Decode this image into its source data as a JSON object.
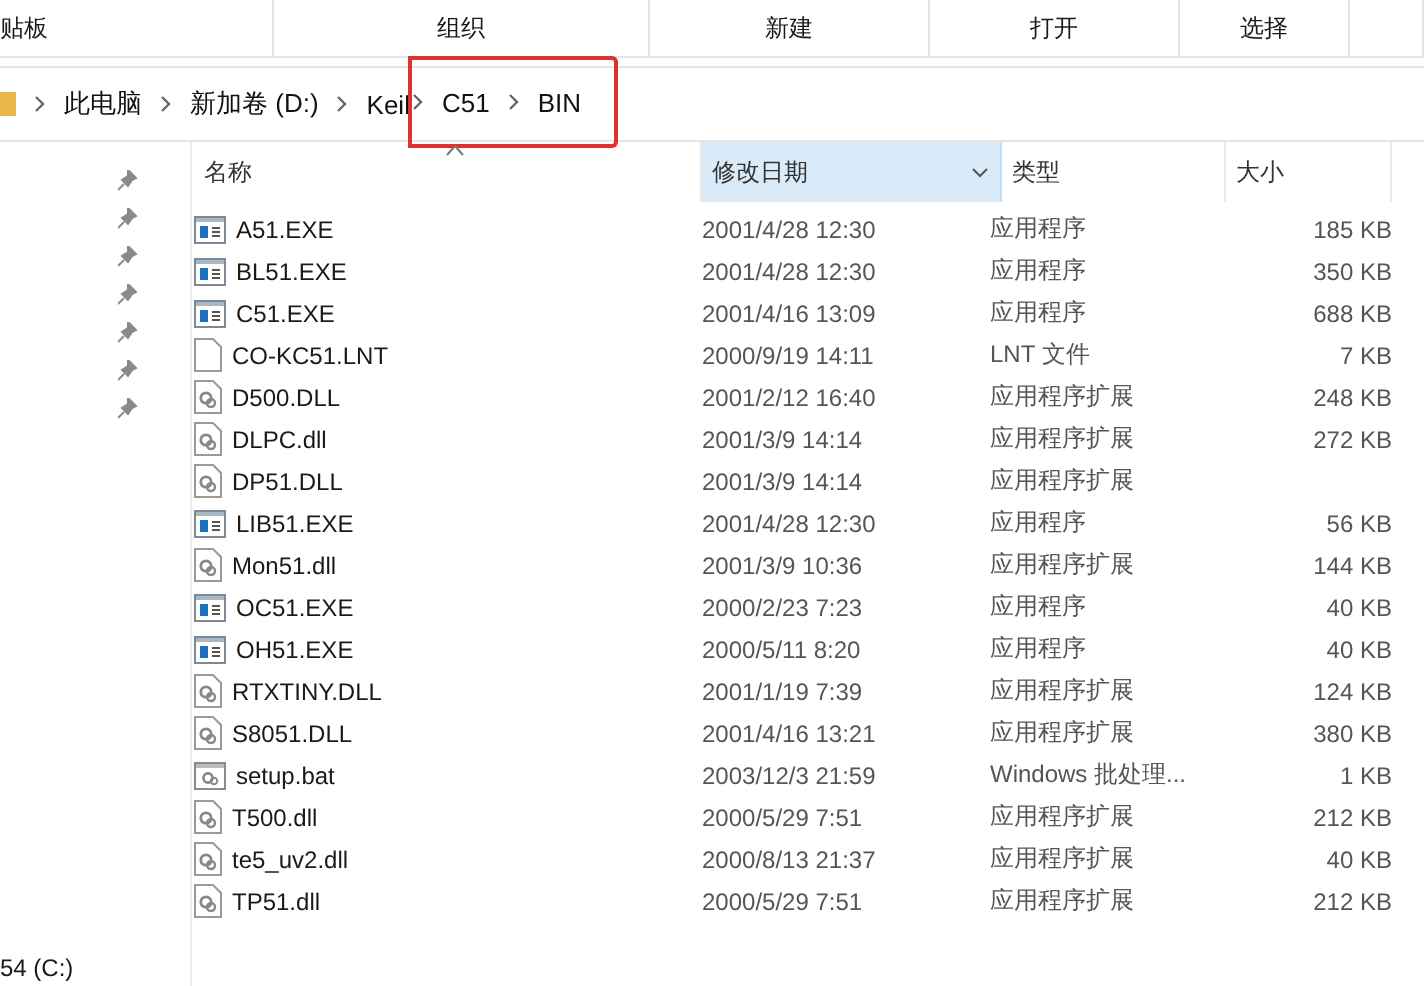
{
  "ribbon": {
    "groups": [
      "贴板",
      "组织",
      "新建",
      "打开",
      "选择"
    ]
  },
  "address_bar": {
    "segments": [
      "此电脑",
      "新加卷 (D:)",
      "Keil"
    ],
    "highlighted_segments": [
      "C51",
      "BIN"
    ]
  },
  "nav_pane": {
    "bottom_item": "54 (C:)"
  },
  "columns": [
    {
      "label": "名称",
      "selected": false,
      "sorted": true
    },
    {
      "label": "修改日期",
      "selected": true,
      "sorted": false
    },
    {
      "label": "类型",
      "selected": false,
      "sorted": false
    },
    {
      "label": "大小",
      "selected": false,
      "sorted": false
    }
  ],
  "files": [
    {
      "name": "A51.EXE",
      "kind": "exe",
      "date": "2001/4/28 12:30",
      "type": "应用程序",
      "size": "185 KB"
    },
    {
      "name": "BL51.EXE",
      "kind": "exe",
      "date": "2001/4/28 12:30",
      "type": "应用程序",
      "size": "350 KB"
    },
    {
      "name": "C51.EXE",
      "kind": "exe",
      "date": "2001/4/16 13:09",
      "type": "应用程序",
      "size": "688 KB"
    },
    {
      "name": "CO-KC51.LNT",
      "kind": "file",
      "date": "2000/9/19 14:11",
      "type": "LNT 文件",
      "size": "7 KB"
    },
    {
      "name": "D500.DLL",
      "kind": "dll",
      "date": "2001/2/12 16:40",
      "type": "应用程序扩展",
      "size": "248 KB"
    },
    {
      "name": "DLPC.dll",
      "kind": "dll",
      "date": "2001/3/9 14:14",
      "type": "应用程序扩展",
      "size": "272 KB"
    },
    {
      "name": "DP51.DLL",
      "kind": "dll",
      "date": "2001/3/9 14:14",
      "type": "应用程序扩展"
    },
    {
      "name": "LIB51.EXE",
      "kind": "exe",
      "date": "2001/4/28 12:30",
      "type": "应用程序",
      "size": "56 KB"
    },
    {
      "name": "Mon51.dll",
      "kind": "dll",
      "date": "2001/3/9 10:36",
      "type": "应用程序扩展",
      "size": "144 KB"
    },
    {
      "name": "OC51.EXE",
      "kind": "exe",
      "date": "2000/2/23 7:23",
      "type": "应用程序",
      "size": "40 KB"
    },
    {
      "name": "OH51.EXE",
      "kind": "exe",
      "date": "2000/5/11 8:20",
      "type": "应用程序",
      "size": "40 KB"
    },
    {
      "name": "RTXTINY.DLL",
      "kind": "dll",
      "date": "2001/1/19 7:39",
      "type": "应用程序扩展",
      "size": "124 KB"
    },
    {
      "name": "S8051.DLL",
      "kind": "dll",
      "date": "2001/4/16 13:21",
      "type": "应用程序扩展",
      "size": "380 KB"
    },
    {
      "name": "setup.bat",
      "kind": "bat",
      "date": "2003/12/3 21:59",
      "type": "Windows 批处理...",
      "size": "1 KB"
    },
    {
      "name": "T500.dll",
      "kind": "dll",
      "date": "2000/5/29 7:51",
      "type": "应用程序扩展",
      "size": "212 KB"
    },
    {
      "name": "te5_uv2.dll",
      "kind": "dll",
      "date": "2000/8/13 21:37",
      "type": "应用程序扩展",
      "size": "40 KB"
    },
    {
      "name": "TP51.dll",
      "kind": "dll",
      "date": "2000/5/29 7:51",
      "type": "应用程序扩展",
      "size": "212 KB"
    }
  ]
}
